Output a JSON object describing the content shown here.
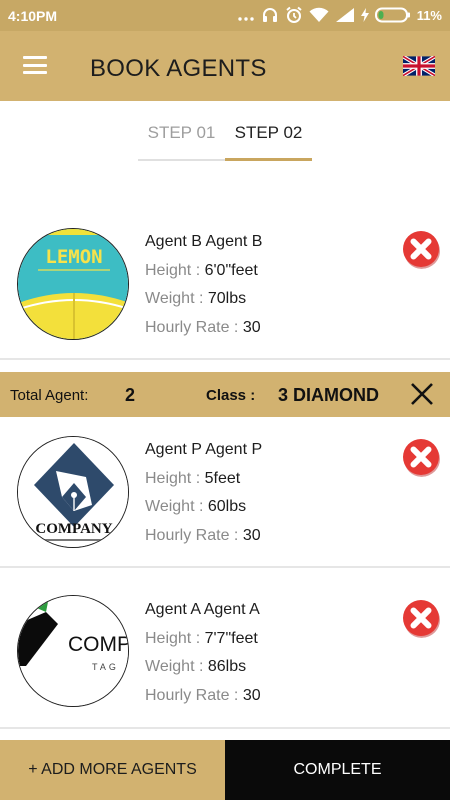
{
  "status": {
    "time": "4:10PM",
    "battery": "11%"
  },
  "header": {
    "title": "BOOK AGENTS",
    "menu_icon": "hamburger-menu-icon",
    "flag_icon": "uk-flag-icon"
  },
  "steps": [
    {
      "label": "STEP 01",
      "active": false
    },
    {
      "label": "STEP 02",
      "active": true
    }
  ],
  "agents": [
    {
      "name": "Agent B Agent B",
      "height_label": "Height : ",
      "height": "6'0\"feet",
      "weight_label": "Weight : ",
      "weight": "70lbs",
      "rate_label": "Hourly Rate : ",
      "rate": "30",
      "avatar_text": "LEMON"
    },
    {
      "name": "Agent P Agent P",
      "height_label": "Height : ",
      "height": "5feet",
      "weight_label": "Weight : ",
      "weight": "60lbs",
      "rate_label": "Hourly Rate : ",
      "rate": "30",
      "avatar_text": "COMPANY"
    },
    {
      "name": "Agent A Agent A",
      "height_label": "Height : ",
      "height": "7'7\"feet",
      "weight_label": "Weight : ",
      "weight": "86lbs",
      "rate_label": "Hourly Rate : ",
      "rate": "30",
      "avatar_text": "COMP"
    }
  ],
  "summary": {
    "total_label": "Total Agent:",
    "total_value": "2",
    "class_label": "Class :",
    "class_value": "3 DIAMOND"
  },
  "actions": {
    "add_more": "+ ADD MORE AGENTS",
    "complete": "COMPLETE"
  },
  "colors": {
    "gold": "#d2b270",
    "gold_dark": "#c7a865",
    "underline": "#c9a65f",
    "remove_red": "#e53935",
    "black": "#0a0a0a"
  }
}
